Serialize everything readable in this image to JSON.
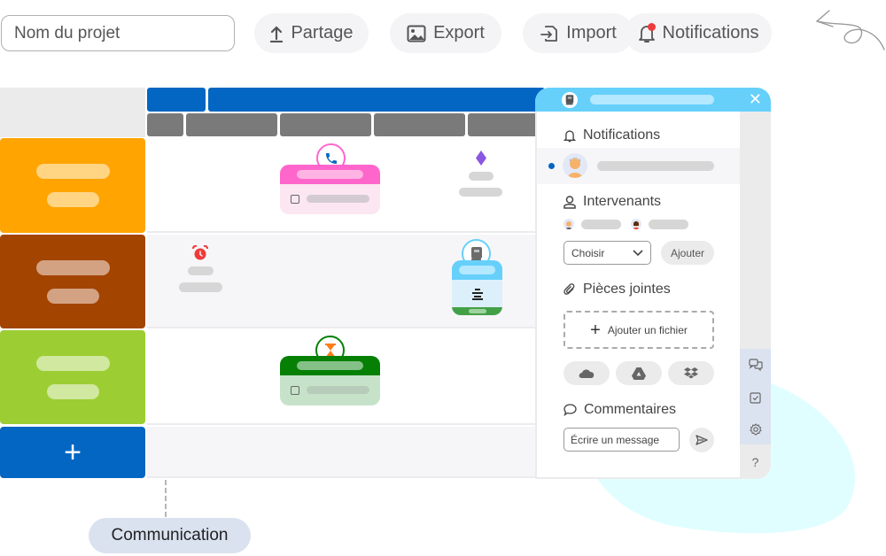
{
  "toolbar": {
    "project_name_placeholder": "Nom du projet",
    "project_name_value": "",
    "buttons": [
      {
        "label": "Partage",
        "icon": "upload-icon"
      },
      {
        "label": "Export",
        "icon": "image-icon"
      },
      {
        "label": "Import",
        "icon": "file-import-icon"
      },
      {
        "label": "Notifications",
        "icon": "bell-icon",
        "has_unread_dot": true
      }
    ]
  },
  "grid": {
    "rows": [
      {
        "color": "#ffa400"
      },
      {
        "color": "#a34400"
      },
      {
        "color": "#9ccd32"
      }
    ],
    "add_row_label": "+",
    "cards": [
      {
        "type": "phone",
        "color": "#ff66cc",
        "has_checkbox": true
      },
      {
        "type": "milestone",
        "color": "#8a56e2"
      },
      {
        "type": "alarm",
        "color": "#ef3b3b"
      },
      {
        "type": "book",
        "color": "#66d0fb"
      },
      {
        "type": "hourglass",
        "color": "#058005",
        "has_checkbox": true
      }
    ]
  },
  "panel": {
    "close_label": "✕",
    "sections": {
      "notifications": "Notifications",
      "intervenants": "Intervenants",
      "pieces_jointes": "Pièces jointes",
      "commentaires": "Commentaires"
    },
    "select_value": "Choisir",
    "add_button": "Ajouter",
    "add_file": "Ajouter un fichier",
    "cloud_services": [
      "cloud-icon",
      "google-drive-icon",
      "dropbox-icon"
    ],
    "message_placeholder": "Écrire un message",
    "rail_icons": [
      "chat-icon",
      "checkbox-icon",
      "gear-icon",
      "help-icon"
    ],
    "help_label": "?"
  },
  "tag": {
    "label": "Communication"
  },
  "colors": {
    "primary": "#0366c2",
    "panel_header": "#66d0fb",
    "blob": "#e0feff"
  }
}
